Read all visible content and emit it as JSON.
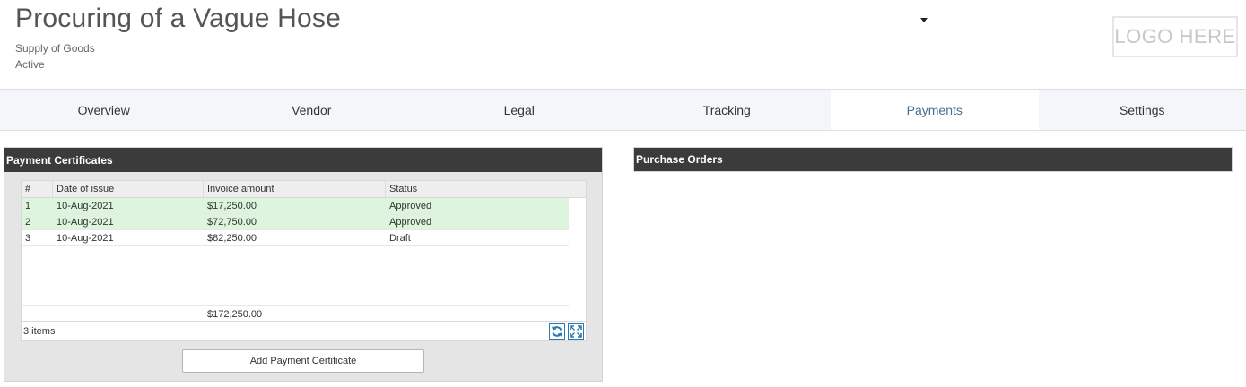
{
  "header": {
    "title": "Procuring of a Vague Hose",
    "subtitle": "Supply of Goods",
    "status": "Active",
    "logo_text": "LOGO HERE"
  },
  "tabs": [
    {
      "label": "Overview",
      "active": false
    },
    {
      "label": "Vendor",
      "active": false
    },
    {
      "label": "Legal",
      "active": false
    },
    {
      "label": "Tracking",
      "active": false
    },
    {
      "label": "Payments",
      "active": true
    },
    {
      "label": "Settings",
      "active": false
    }
  ],
  "payment_certificates": {
    "title": "Payment Certificates",
    "columns": [
      "#",
      "Date of issue",
      "Invoice amount",
      "Status"
    ],
    "rows": [
      {
        "num": "1",
        "date": "10-Aug-2021",
        "amount": "$17,250.00",
        "status": "Approved"
      },
      {
        "num": "2",
        "date": "10-Aug-2021",
        "amount": "$72,750.00",
        "status": "Approved"
      },
      {
        "num": "3",
        "date": "10-Aug-2021",
        "amount": "$82,250.00",
        "status": "Draft"
      }
    ],
    "total": "$172,250.00",
    "pager_info": "3 items",
    "add_button_label": "Add Payment Certificate"
  },
  "purchase_orders": {
    "title": "Purchase Orders"
  },
  "icons": {
    "dropdown": "caret-down-icon",
    "refresh": "refresh-icon",
    "expand": "expand-icon"
  },
  "colors": {
    "approved_row": "#dcf5dc",
    "panel_header": "#3b3b3b",
    "active_tab_text": "#4a6e8f",
    "pager_button": "#2a7ab0"
  }
}
